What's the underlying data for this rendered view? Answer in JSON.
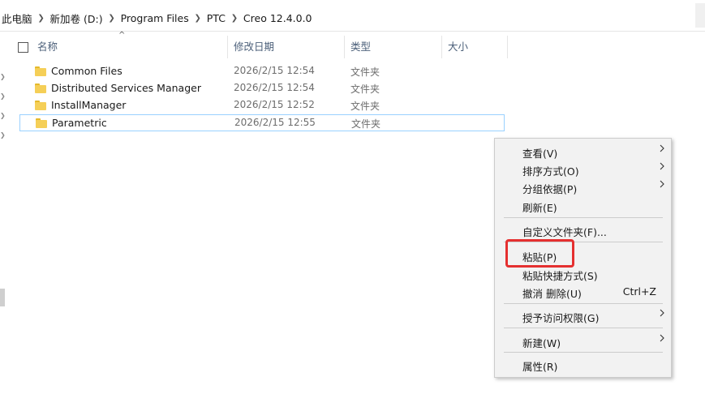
{
  "breadcrumb": [
    "此电脑",
    "新加卷 (D:)",
    "Program Files",
    "PTC",
    "Creo 12.4.0.0"
  ],
  "headers": {
    "name": "名称",
    "modified": "修改日期",
    "type": "类型",
    "size": "大小"
  },
  "files": [
    {
      "name": "Common Files",
      "modified": "2026/2/15 12:54",
      "type": "文件夹"
    },
    {
      "name": "Distributed Services Manager",
      "modified": "2026/2/15 12:54",
      "type": "文件夹"
    },
    {
      "name": "InstallManager",
      "modified": "2026/2/15 12:52",
      "type": "文件夹"
    },
    {
      "name": "Parametric",
      "modified": "2026/2/15 12:55",
      "type": "文件夹"
    }
  ],
  "context_menu": {
    "view": "查看(V)",
    "sort_by": "排序方式(O)",
    "group_by": "分组依据(P)",
    "refresh": "刷新(E)",
    "customize": "自定义文件夹(F)...",
    "paste": "粘贴(P)",
    "paste_shortcut": "粘贴快捷方式(S)",
    "undo_delete": "撤消 删除(U)",
    "undo_shortcut": "Ctrl+Z",
    "give_access": "授予访问权限(G)",
    "new": "新建(W)",
    "properties": "属性(R)"
  },
  "colors": {
    "highlight": "#e53030",
    "folder": "#f5cf57",
    "selection": "#99d1ff"
  }
}
